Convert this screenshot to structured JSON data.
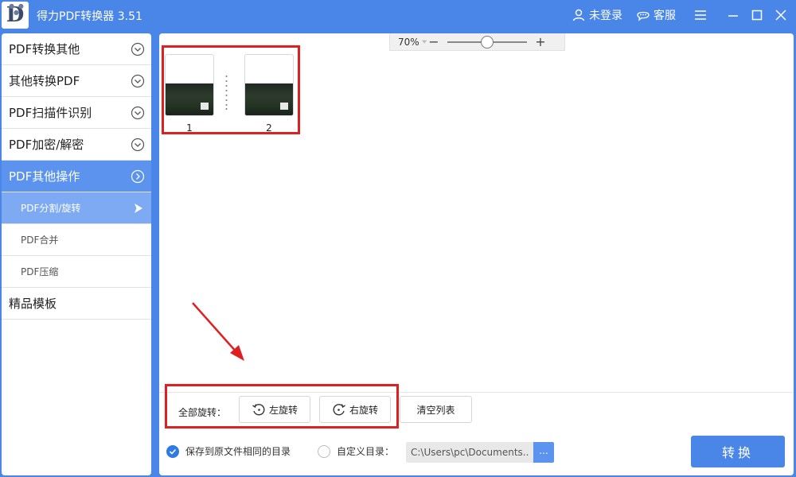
{
  "titlebar": {
    "title": "得力PDF转换器 3.51",
    "logo_letter": "D",
    "login_label": "未登录",
    "service_label": "客服"
  },
  "sidebar": {
    "items": [
      {
        "label": "PDF转换其他"
      },
      {
        "label": "其他转换PDF"
      },
      {
        "label": "PDF扫描件识别"
      },
      {
        "label": "PDF加密/解密"
      },
      {
        "label": "PDF其他操作"
      }
    ],
    "subitems": [
      {
        "label": "PDF分割/旋转"
      },
      {
        "label": "PDF合并"
      },
      {
        "label": "PDF压缩"
      }
    ],
    "templates_label": "精品模板"
  },
  "zoom": {
    "level": "70%",
    "minus": "−",
    "plus": "+",
    "slider_fraction": 0.5
  },
  "pages": [
    {
      "number": "1"
    },
    {
      "number": "2"
    }
  ],
  "controls": {
    "rotate_all_label": "全部旋转：",
    "rotate_left_label": "左旋转",
    "rotate_right_label": "右旋转",
    "clear_list_label": "清空列表"
  },
  "output": {
    "same_dir_label": "保存到原文件相同的目录",
    "custom_dir_label": "自定义目录：",
    "custom_dir_value": "C:\\Users\\pc\\Documents...",
    "browse_label": "...",
    "convert_label": "转换"
  },
  "colors": {
    "accent": "#4a86e8",
    "highlight": "#e02020"
  }
}
